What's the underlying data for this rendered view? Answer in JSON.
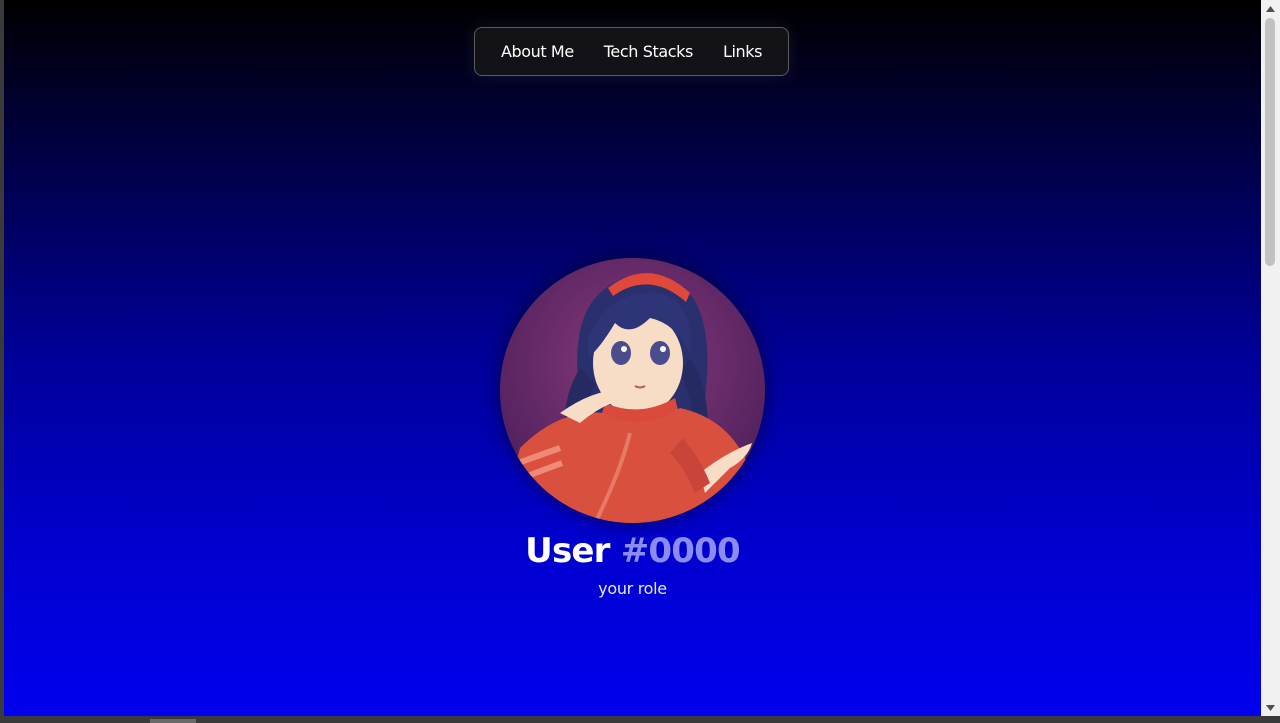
{
  "nav": {
    "items": [
      {
        "label": "About Me"
      },
      {
        "label": "Tech Stacks"
      },
      {
        "label": "Links"
      }
    ]
  },
  "profile": {
    "avatar_icon": "anime-girl-avatar",
    "name": "User",
    "tag": "#0000",
    "role": "your role"
  },
  "colors": {
    "gradient_top": "#000000",
    "gradient_bottom": "#0000ee",
    "tag_color": "#8c8cf0",
    "nav_background": "#141418"
  }
}
